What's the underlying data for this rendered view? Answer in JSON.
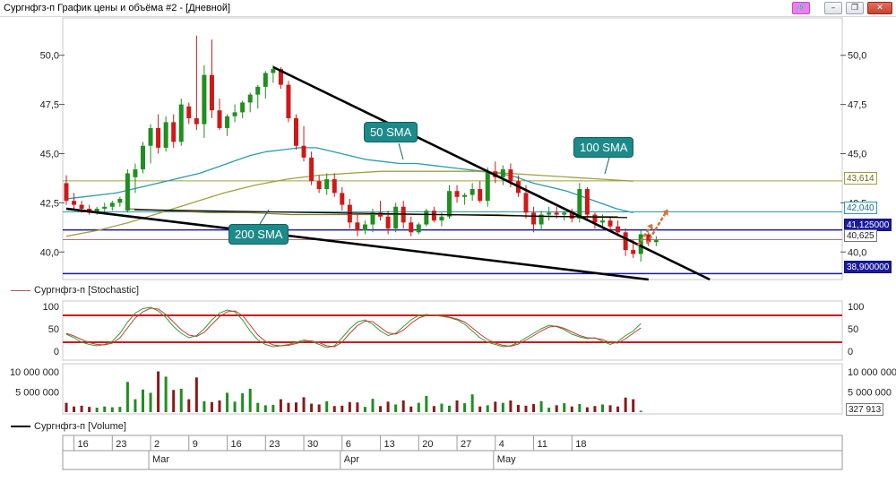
{
  "window": {
    "title": "Сургнфгз-п График цены и объёма #2 - [Дневной]",
    "buttons": {
      "link": "🔗",
      "minimize": "–",
      "restore": "❐",
      "close": "✕"
    }
  },
  "price_panel": {
    "y_ticks": [
      "50,0",
      "47,5",
      "45,0",
      "42,5",
      "40,0"
    ],
    "y_values": [
      50.0,
      47.5,
      45.0,
      42.5,
      40.0
    ],
    "badges": {
      "sma100_value": "43,614",
      "sma50_value": "42,040",
      "level_1": "41,125000",
      "last_price": "40,625",
      "level_2": "38,900000"
    },
    "notes": {
      "sma50": "50 SMA",
      "sma100": "100 SMA",
      "sma200": "200 SMA"
    }
  },
  "stochastic_panel": {
    "legend": "Сургнфгз-п [Stochastic]",
    "y_ticks": [
      "100",
      "50",
      "0"
    ]
  },
  "volume_panel": {
    "legend": "Сургнфгз-п [Volume]",
    "y_ticks": [
      "10 000 000",
      "5 000 000"
    ],
    "last_volume": "327 913"
  },
  "date_axis": {
    "days": [
      "16",
      "23",
      "2",
      "9",
      "16",
      "23",
      "30",
      "6",
      "13",
      "20",
      "27",
      "4",
      "11",
      "18"
    ],
    "months": [
      "Mar",
      "Apr",
      "May"
    ]
  },
  "colors": {
    "up": "#1f8f1f",
    "down": "#d01818",
    "sma50": "#2a9ab0",
    "sma100": "#a0a040",
    "sma200": "#8a7a2a",
    "trend": "#000000",
    "level_blue": "#1a1a9a",
    "stoch_band": "#d01818"
  },
  "chart_data": [
    {
      "type": "candlestick",
      "title": "Сургнфгз-п График цены и объёма #2 - [Дневной]",
      "ylim": [
        38.6,
        51.9
      ],
      "x_start": "2022-02-14",
      "candles": [
        [
          43.5,
          43.9,
          42.4,
          42.6
        ],
        [
          42.6,
          43.0,
          42.2,
          42.4
        ],
        [
          42.4,
          42.6,
          42.0,
          42.2
        ],
        [
          42.2,
          42.4,
          41.9,
          42.0
        ],
        [
          42.0,
          42.3,
          41.9,
          42.2
        ],
        [
          42.2,
          42.5,
          42.0,
          42.3
        ],
        [
          42.3,
          42.6,
          42.1,
          42.5
        ],
        [
          42.5,
          42.8,
          42.3,
          42.7
        ],
        [
          42.1,
          44.2,
          42.0,
          44.0
        ],
        [
          43.8,
          44.5,
          43.0,
          44.2
        ],
        [
          44.2,
          45.6,
          44.0,
          45.4
        ],
        [
          45.4,
          46.5,
          44.5,
          46.3
        ],
        [
          46.3,
          47.0,
          45.0,
          45.3
        ],
        [
          45.3,
          46.9,
          45.1,
          46.6
        ],
        [
          46.6,
          47.0,
          45.3,
          45.6
        ],
        [
          45.6,
          47.8,
          45.4,
          47.5
        ],
        [
          47.4,
          47.6,
          46.5,
          46.8
        ],
        [
          46.8,
          51.0,
          46.2,
          46.5
        ],
        [
          46.5,
          49.5,
          45.8,
          49.0
        ],
        [
          49.0,
          50.8,
          46.8,
          47.2
        ],
        [
          47.2,
          47.8,
          46.2,
          46.3
        ],
        [
          46.3,
          47.0,
          45.9,
          46.9
        ],
        [
          46.9,
          47.5,
          46.6,
          47.1
        ],
        [
          47.1,
          47.7,
          46.8,
          47.6
        ],
        [
          47.6,
          48.1,
          47.1,
          48.0
        ],
        [
          48.0,
          48.5,
          47.3,
          48.4
        ],
        [
          48.4,
          49.2,
          47.8,
          49.1
        ],
        [
          49.1,
          49.5,
          48.6,
          49.3
        ],
        [
          49.3,
          49.4,
          48.3,
          48.5
        ],
        [
          48.5,
          48.7,
          46.6,
          46.8
        ],
        [
          46.8,
          47.0,
          45.2,
          45.4
        ],
        [
          45.4,
          46.4,
          44.6,
          44.8
        ],
        [
          44.8,
          45.1,
          43.4,
          43.6
        ],
        [
          43.6,
          43.9,
          43.0,
          43.2
        ],
        [
          43.2,
          44.0,
          42.9,
          43.7
        ],
        [
          43.7,
          44.0,
          42.8,
          43.0
        ],
        [
          43.0,
          43.3,
          42.1,
          42.4
        ],
        [
          42.4,
          42.7,
          41.2,
          41.5
        ],
        [
          41.5,
          41.9,
          40.8,
          41.1
        ],
        [
          41.1,
          41.6,
          40.9,
          41.4
        ],
        [
          41.4,
          42.2,
          41.0,
          42.0
        ],
        [
          42.0,
          42.6,
          41.6,
          41.8
        ],
        [
          41.8,
          42.1,
          40.9,
          41.2
        ],
        [
          41.2,
          42.5,
          41.0,
          42.3
        ],
        [
          42.3,
          42.6,
          41.2,
          41.5
        ],
        [
          41.5,
          41.8,
          40.8,
          41.0
        ],
        [
          41.0,
          41.5,
          40.9,
          41.4
        ],
        [
          41.4,
          42.2,
          41.3,
          42.1
        ],
        [
          42.1,
          42.3,
          41.5,
          41.6
        ],
        [
          41.6,
          42.0,
          41.3,
          41.8
        ],
        [
          41.8,
          43.4,
          41.7,
          43.1
        ],
        [
          43.1,
          43.4,
          42.5,
          42.8
        ],
        [
          42.8,
          43.0,
          42.4,
          42.9
        ],
        [
          42.9,
          43.5,
          42.6,
          43.2
        ],
        [
          43.2,
          43.6,
          42.5,
          42.6
        ],
        [
          42.6,
          44.3,
          42.3,
          44.1
        ],
        [
          44.1,
          44.6,
          43.5,
          43.8
        ],
        [
          43.8,
          44.4,
          43.4,
          44.2
        ],
        [
          44.2,
          44.5,
          43.3,
          43.6
        ],
        [
          43.6,
          43.9,
          42.8,
          43.0
        ],
        [
          43.0,
          43.4,
          41.7,
          42.0
        ],
        [
          42.0,
          42.3,
          41.0,
          41.4
        ],
        [
          41.4,
          42.1,
          41.1,
          41.9
        ],
        [
          41.9,
          42.3,
          41.6,
          42.0
        ],
        [
          42.0,
          42.3,
          41.7,
          41.9
        ],
        [
          41.9,
          42.1,
          41.6,
          42.0
        ],
        [
          42.0,
          42.2,
          41.5,
          41.7
        ],
        [
          41.7,
          43.5,
          41.5,
          43.2
        ],
        [
          43.2,
          43.3,
          41.6,
          41.9
        ],
        [
          41.9,
          42.0,
          41.2,
          41.5
        ],
        [
          41.5,
          41.9,
          41.3,
          41.6
        ],
        [
          41.6,
          41.8,
          41.1,
          41.3
        ],
        [
          41.3,
          41.6,
          40.8,
          41.0
        ],
        [
          41.0,
          41.2,
          39.8,
          40.1
        ],
        [
          40.1,
          40.6,
          39.7,
          39.9
        ],
        [
          39.9,
          41.1,
          39.5,
          40.9
        ],
        [
          40.9,
          41.0,
          40.3,
          40.5
        ],
        [
          40.5,
          40.8,
          40.3,
          40.6
        ]
      ],
      "sma50": [
        42.7,
        42.8,
        42.9,
        43.0,
        43.2,
        43.4,
        43.6,
        43.8,
        44.0,
        44.3,
        44.6,
        44.9,
        45.1,
        45.2,
        45.3,
        45.3,
        45.1,
        44.9,
        44.7,
        44.6,
        44.5,
        44.5,
        44.4,
        44.3,
        44.2,
        44.1,
        44.0,
        43.8,
        43.5,
        43.3,
        43.1,
        42.8,
        42.5,
        42.2,
        42.0
      ],
      "sma100": [
        40.8,
        41.1,
        41.5,
        42.0,
        42.5,
        43.0,
        43.4,
        43.7,
        43.9,
        44.0,
        44.1,
        44.1,
        44.1,
        44.1,
        44.0,
        43.9,
        43.8,
        43.7,
        43.6
      ],
      "sma200": [
        42.2,
        42.1,
        42.0,
        42.0,
        41.9,
        41.9,
        41.9,
        41.9,
        41.9,
        41.9,
        41.8,
        41.8,
        41.8
      ],
      "levels": [
        43.614,
        42.04,
        41.125,
        40.625,
        38.9
      ],
      "trendlines": [
        {
          "from": [
            0,
            42.2
          ],
          "to": [
            76,
            38.6
          ]
        },
        {
          "from": [
            27,
            49.4
          ],
          "to": [
            84,
            38.6
          ]
        }
      ]
    },
    {
      "type": "line",
      "title": "Сургнфгз-п [Stochastic]",
      "ylim": [
        0,
        100
      ],
      "bands": [
        80,
        20
      ],
      "series": [
        {
          "values": [
            38,
            30,
            20,
            15,
            12,
            15,
            22,
            40,
            65,
            85,
            95,
            98,
            90,
            75,
            55,
            40,
            30,
            35,
            50,
            70,
            85,
            92,
            88,
            70,
            45,
            25,
            15,
            10,
            12,
            15,
            20,
            25,
            22,
            15,
            8,
            12,
            30,
            50,
            65,
            70,
            60,
            45,
            35,
            40,
            55,
            70,
            80,
            82,
            80,
            78,
            75,
            70,
            60,
            45,
            30,
            20,
            15,
            10,
            12,
            20,
            30,
            40,
            50,
            58,
            55,
            48,
            38,
            32,
            28,
            30,
            22,
            15,
            22,
            35,
            45,
            62
          ]
        },
        {
          "values": [
            40,
            34,
            26,
            19,
            15,
            14,
            18,
            30,
            52,
            74,
            88,
            96,
            94,
            82,
            65,
            48,
            36,
            33,
            42,
            60,
            77,
            88,
            90,
            80,
            58,
            36,
            22,
            14,
            12,
            13,
            17,
            22,
            23,
            19,
            12,
            10,
            20,
            40,
            57,
            67,
            66,
            53,
            41,
            38,
            47,
            62,
            74,
            80,
            81,
            79,
            76,
            72,
            65,
            52,
            38,
            26,
            18,
            13,
            11,
            16,
            25,
            35,
            45,
            54,
            56,
            51,
            43,
            35,
            30,
            29,
            26,
            19,
            18,
            28,
            40,
            52
          ]
        }
      ]
    },
    {
      "type": "bar",
      "title": "Сургнфгз-п [Volume]",
      "ylim": [
        0,
        12000000
      ],
      "values": [
        2300000,
        1400000,
        1600000,
        1300000,
        1100000,
        1400000,
        1200000,
        1300000,
        7500000,
        3200000,
        5600000,
        4800000,
        10100000,
        8800000,
        5500000,
        5800000,
        3200000,
        8600000,
        2700000,
        2500000,
        2900000,
        4800000,
        2600000,
        4700000,
        5800000,
        2300000,
        1700000,
        1800000,
        3200000,
        2300000,
        2400000,
        3700000,
        2100000,
        1900000,
        2700000,
        1500000,
        1600000,
        2500000,
        2400000,
        1300000,
        3300000,
        1500000,
        2600000,
        1900000,
        2900000,
        1400000,
        2300000,
        4000000,
        1500000,
        2100000,
        1600000,
        2900000,
        2200000,
        4400000,
        1400000,
        1700000,
        2600000,
        2300000,
        2900000,
        1800000,
        1600000,
        2000000,
        2700000,
        1100000,
        1700000,
        2200000,
        1400000,
        2000000,
        1200000,
        1500000,
        1900000,
        1700000,
        1400000,
        3600000,
        3200000,
        327913
      ]
    }
  ]
}
